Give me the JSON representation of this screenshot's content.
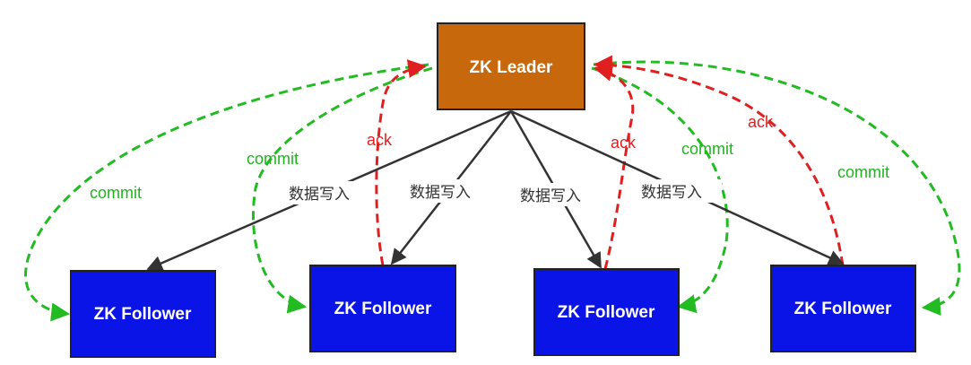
{
  "colors": {
    "leader_fill": "#c8680c",
    "follower_fill": "#0a14e6",
    "write_edge": "#333333",
    "ack_edge": "#e02020",
    "commit_edge": "#22bb22"
  },
  "leader": {
    "label": "ZK Leader"
  },
  "followers": [
    {
      "label": "ZK Follower"
    },
    {
      "label": "ZK Follower"
    },
    {
      "label": "ZK Follower"
    },
    {
      "label": "ZK Follower"
    }
  ],
  "edges": {
    "write_label": "数据写入",
    "ack_label": "ack",
    "commit_label": "commit"
  }
}
